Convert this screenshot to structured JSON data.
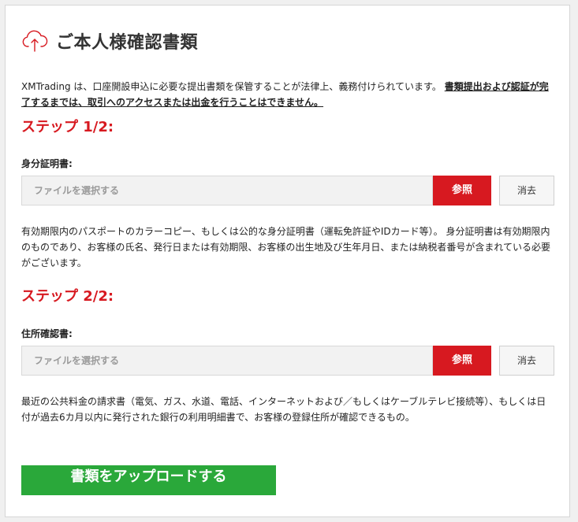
{
  "header": {
    "title": "ご本人様確認書類",
    "icon": "cloud-upload-icon"
  },
  "intro": {
    "text": "XMTrading は、口座開設申込に必要な提出書類を保管することが法律上、義務付けられています。",
    "emphasis": "書類提出および認証が完了するまでは、取引へのアクセスまたは出金を行うことはできません。"
  },
  "step1": {
    "label": "ステップ 1/2:",
    "field_label": "身分証明書:",
    "file_placeholder": "ファイルを選択する",
    "browse_label": "参照",
    "clear_label": "消去",
    "description": "有効期限内のパスポートのカラーコピー、もしくは公的な身分証明書（運転免許証やIDカード等）。 身分証明書は有効期限内のものであり、お客様の氏名、発行日または有効期限、お客様の出生地及び生年月日、または納税者番号が含まれている必要がございます。"
  },
  "step2": {
    "label": "ステップ 2/2:",
    "field_label": "住所確認書:",
    "file_placeholder": "ファイルを選択する",
    "browse_label": "参照",
    "clear_label": "消去",
    "description": "最近の公共料金の請求書（電気、ガス、水道、電話、インターネットおよび／もしくはケーブルテレビ接続等）、もしくは日付が過去6カ月以内に発行された銀行の利用明細書で、お客様の登録住所が確認できるもの。"
  },
  "upload_button": {
    "label": "書類をアップロードする"
  },
  "colors": {
    "accent_red": "#d71920",
    "upload_green": "#2aa83a"
  }
}
